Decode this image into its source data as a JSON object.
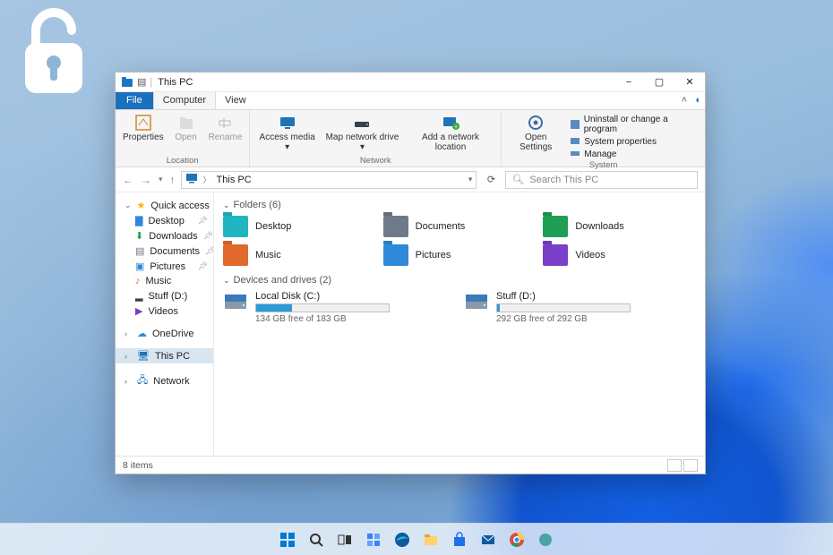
{
  "window": {
    "title": "This PC",
    "menu": {
      "file": "File",
      "computer": "Computer",
      "view": "View"
    },
    "controls": {
      "min": "−",
      "max": "▢",
      "close": "✕"
    }
  },
  "ribbon": {
    "location": {
      "label": "Location",
      "properties": "Properties",
      "open": "Open",
      "rename": "Rename"
    },
    "network": {
      "label": "Network",
      "access_media": "Access media ▾",
      "map_drive": "Map network drive ▾",
      "add_location": "Add a network location"
    },
    "system": {
      "label": "System",
      "open_settings": "Open Settings",
      "uninstall": "Uninstall or change a program",
      "properties": "System properties",
      "manage": "Manage"
    }
  },
  "nav": {
    "breadcrumb_root": "This PC",
    "search_placeholder": "Search This PC"
  },
  "sidebar": {
    "quick_access": "Quick access",
    "items": [
      {
        "label": "Desktop"
      },
      {
        "label": "Downloads"
      },
      {
        "label": "Documents"
      },
      {
        "label": "Pictures"
      },
      {
        "label": "Music"
      },
      {
        "label": "Stuff (D:)"
      },
      {
        "label": "Videos"
      }
    ],
    "onedrive": "OneDrive",
    "this_pc": "This PC",
    "network": "Network"
  },
  "content": {
    "folders_header": "Folders (6)",
    "folders": [
      {
        "label": "Desktop",
        "color": "#1fb6c1"
      },
      {
        "label": "Documents",
        "color": "#6f7a88"
      },
      {
        "label": "Downloads",
        "color": "#1f9e55"
      },
      {
        "label": "Music",
        "color": "#e06a2b"
      },
      {
        "label": "Pictures",
        "color": "#2e8ad8"
      },
      {
        "label": "Videos",
        "color": "#7a3fc9"
      }
    ],
    "drives_header": "Devices and drives (2)",
    "drives": [
      {
        "label": "Local Disk (C:)",
        "free": "134 GB free of 183 GB",
        "fill_pct": 27
      },
      {
        "label": "Stuff (D:)",
        "free": "292 GB free of 292 GB",
        "fill_pct": 2
      }
    ]
  },
  "status": {
    "items": "8 items"
  },
  "taskbar": [
    "start-icon",
    "search-icon",
    "task-view-icon",
    "widgets-icon",
    "edge-icon",
    "explorer-icon",
    "store-icon",
    "mail-icon",
    "chrome-icon",
    "settings-icon"
  ]
}
